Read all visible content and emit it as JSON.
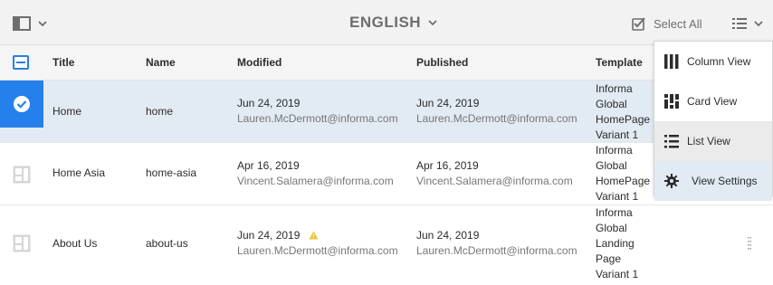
{
  "topbar": {
    "title": "ENGLISH",
    "select_all_label": "Select All"
  },
  "columns": {
    "title": "Title",
    "name": "Name",
    "modified": "Modified",
    "published": "Published",
    "template": "Template"
  },
  "rows": [
    {
      "title": "Home",
      "name": "home",
      "modified_date": "Jun 24, 2019",
      "modified_by": "Lauren.McDermott@informa.com",
      "published_date": "Jun 24, 2019",
      "published_by": "Lauren.McDermott@informa.com",
      "template": [
        "Informa",
        "Global",
        "HomePage",
        "Variant 1"
      ],
      "selected": true
    },
    {
      "title": "Home Asia",
      "name": "home-asia",
      "modified_date": "Apr 16, 2019",
      "modified_by": "Vincent.Salamera@informa.com",
      "published_date": "Apr 16, 2019",
      "published_by": "Vincent.Salamera@informa.com",
      "template": [
        "Informa",
        "Global",
        "HomePage",
        "Variant 1"
      ],
      "selected": false
    },
    {
      "title": "About Us",
      "name": "about-us",
      "modified_date": "Jun 24, 2019",
      "modified_by": "Lauren.McDermott@informa.com",
      "published_date": "Jun 24, 2019",
      "published_by": "Lauren.McDermott@informa.com",
      "template": [
        "Informa",
        "Global",
        "Landing",
        "Page",
        "Variant 1"
      ],
      "selected": false,
      "warning": true
    }
  ],
  "view_menu": {
    "items": [
      {
        "label": "Column View",
        "icon": "column-view-icon"
      },
      {
        "label": "Card View",
        "icon": "card-view-icon"
      },
      {
        "label": "List View",
        "icon": "list-view-icon",
        "active": true
      },
      {
        "label": "View Settings",
        "icon": "gear-icon"
      }
    ]
  },
  "colors": {
    "accent": "#2680eb",
    "selected_row": "#e2eaf4",
    "warning": "#e8c43a"
  }
}
